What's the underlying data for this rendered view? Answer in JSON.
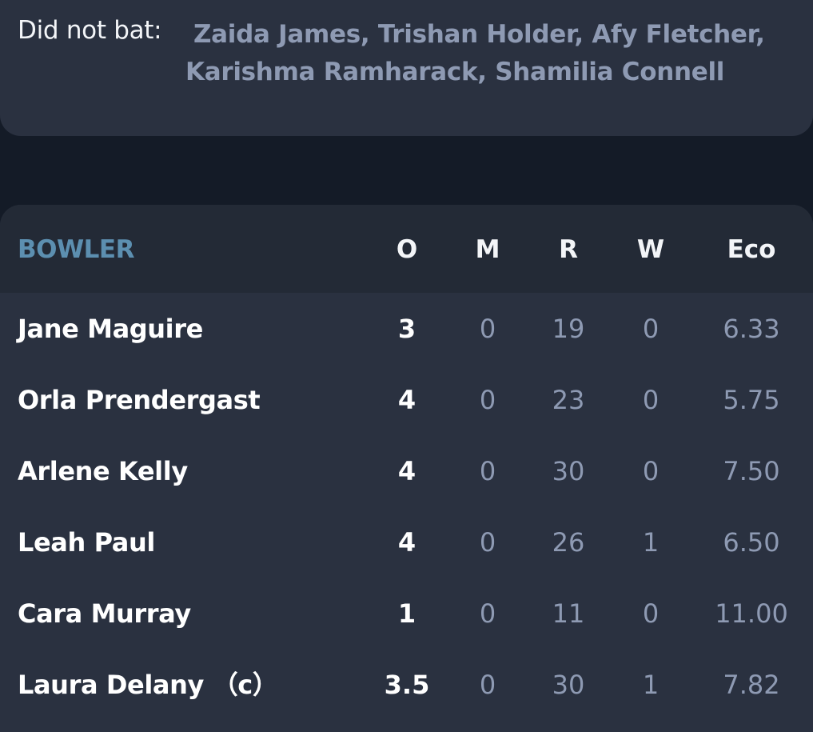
{
  "did_not_bat": {
    "label": "Did not bat:",
    "names": "Zaida James, Trishan Holder, Afy Fletcher, Karishma Ramharack, Shamilia Connell"
  },
  "bowling": {
    "headers": {
      "bowler": "BOWLER",
      "overs": "O",
      "maidens": "M",
      "runs": "R",
      "wickets": "W",
      "economy": "Eco"
    },
    "rows": [
      {
        "name": "Jane Maguire",
        "overs": "3",
        "maidens": "0",
        "runs": "19",
        "wickets": "0",
        "economy": "6.33"
      },
      {
        "name": "Orla Prendergast",
        "overs": "4",
        "maidens": "0",
        "runs": "23",
        "wickets": "0",
        "economy": "5.75"
      },
      {
        "name": "Arlene Kelly",
        "overs": "4",
        "maidens": "0",
        "runs": "30",
        "wickets": "0",
        "economy": "7.50"
      },
      {
        "name": "Leah Paul",
        "overs": "4",
        "maidens": "0",
        "runs": "26",
        "wickets": "1",
        "economy": "6.50"
      },
      {
        "name": "Cara Murray",
        "overs": "1",
        "maidens": "0",
        "runs": "11",
        "wickets": "0",
        "economy": "11.00"
      },
      {
        "name": "Laura Delany （c）",
        "overs": "3.5",
        "maidens": "0",
        "runs": "30",
        "wickets": "1",
        "economy": "7.82"
      }
    ]
  },
  "colors": {
    "background": "#141b27",
    "card": "#2a3140",
    "header": "#232a36",
    "accent": "#5c8fb0",
    "muted_text": "#8e9ab3"
  }
}
